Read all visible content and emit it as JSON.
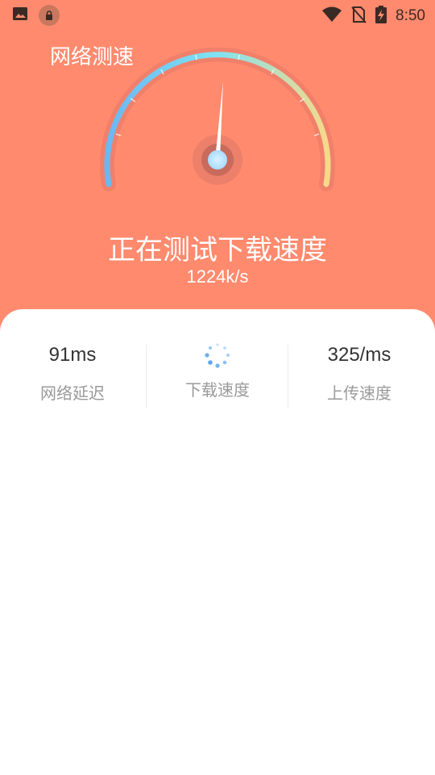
{
  "status_bar": {
    "time": "8:50"
  },
  "header": {
    "title": "网络测速"
  },
  "gauge": {
    "needle_fraction": 0.5
  },
  "test": {
    "status": "正在测试下载速度",
    "speed": "1224k/s"
  },
  "metrics": [
    {
      "value": "91ms",
      "label": "网络延迟"
    },
    {
      "value": "",
      "label": "下载速度",
      "loading": true
    },
    {
      "value": "325/ms",
      "label": "上传速度"
    }
  ],
  "colors": {
    "background": "#ff8a6e",
    "gauge_start": "#6ab7f5",
    "gauge_mid": "#7fe3f0",
    "gauge_end": "#f7d98a"
  }
}
